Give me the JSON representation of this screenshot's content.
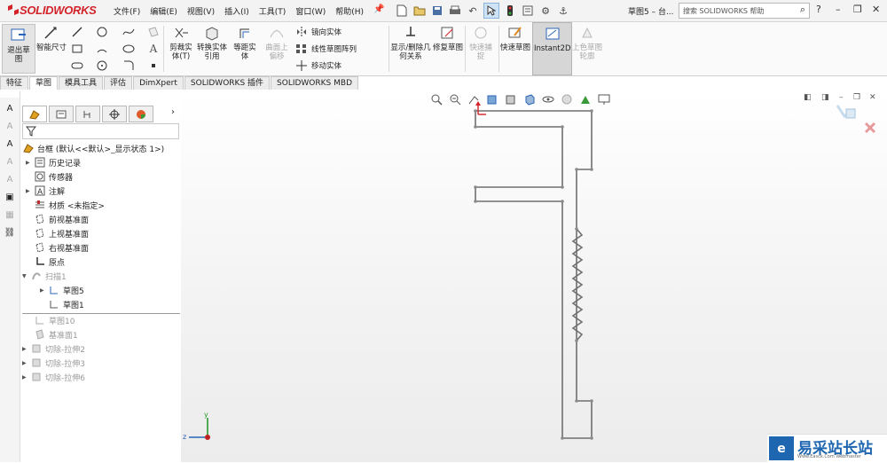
{
  "app": {
    "name": "SOLIDWORKS",
    "doc_title": "草图5 – 台..."
  },
  "menu": [
    "文件(F)",
    "编辑(E)",
    "视图(V)",
    "插入(I)",
    "工具(T)",
    "窗口(W)",
    "帮助(H)"
  ],
  "search": {
    "placeholder": "搜索 SOLIDWORKS 帮助"
  },
  "window": {
    "help": "?",
    "minimize": "–",
    "restore": "❐",
    "close": "✕"
  },
  "ribbon": {
    "exit_sketch": "退出草图",
    "smart_dim": "智能尺寸",
    "trim": "剪裁实体(T)",
    "convert": "转换实体引用",
    "offset": "等距实体",
    "surface_offset": "曲面上偏移",
    "mirror": "镜向实体",
    "linear_pattern": "线性草图阵列",
    "move": "移动实体",
    "display_delete": "显示/删除几何关系",
    "repair": "修复草图",
    "quick_snap": "快速捕捉",
    "rapid_sketch": "快速草图",
    "instant2d": "Instant2D",
    "shaded_contour": "上色草图轮廓"
  },
  "tabs": [
    "特征",
    "草图",
    "模具工具",
    "评估",
    "DimXpert",
    "SOLIDWORKS 插件",
    "SOLIDWORKS MBD"
  ],
  "active_tab": "草图",
  "tree": {
    "root": "台框 (默认<<默认>_显示状态 1>)",
    "history": "历史记录",
    "sensors": "传感器",
    "annotations": "注解",
    "material": "材质 <未指定>",
    "front": "前视基准面",
    "top": "上视基准面",
    "right": "右视基准面",
    "origin": "原点",
    "sweep": "扫描1",
    "sketch5": "草图5",
    "sketch1": "草图1",
    "sketch10": "草图10",
    "plane1": "基准面1",
    "cut2": "切除-拉伸2",
    "cut3": "切除-拉伸3",
    "cut6": "切除-拉伸6"
  },
  "axes": {
    "x": "x",
    "y": "y",
    "z": "z"
  },
  "watermark": {
    "title": "易采站长站",
    "sub": "Www.Easck.Com Webmaster"
  },
  "colors": {
    "accent": "#d2232a",
    "sketch": "#6f6f6f",
    "brand": "#1e66b0"
  }
}
